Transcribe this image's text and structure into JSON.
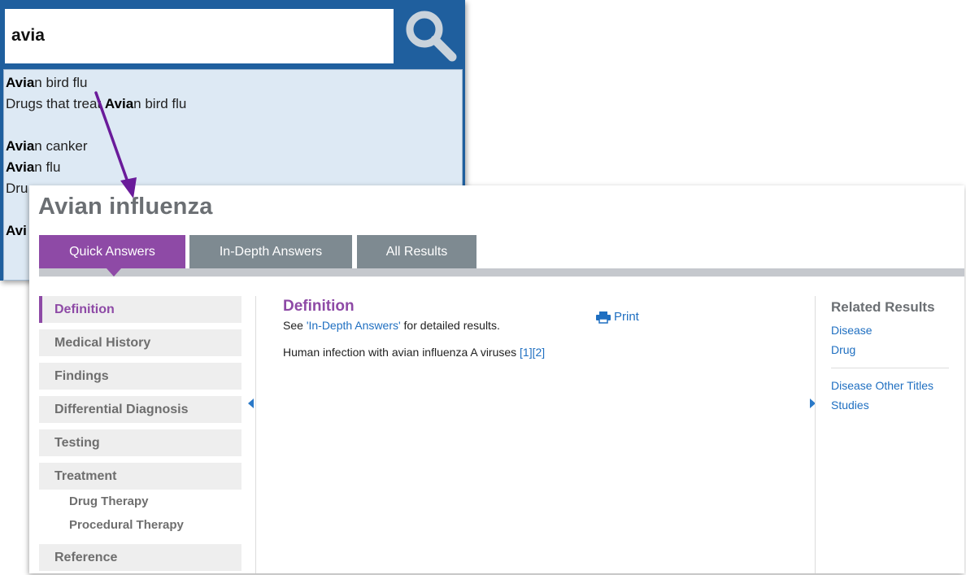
{
  "search": {
    "query": "avia",
    "suggestions": [
      {
        "match": "Avia",
        "rest": "n bird flu"
      },
      {
        "prefix": "Drugs that treat ",
        "match": "Avia",
        "rest": "n bird flu"
      },
      {
        "match": "Avia",
        "rest": "n canker"
      },
      {
        "match": "Avia",
        "rest": "n flu"
      },
      {
        "text": "Dru"
      },
      {
        "text": "Avi"
      }
    ]
  },
  "main": {
    "title": "Avian influenza",
    "tabs": [
      "Quick Answers",
      "In-Depth Answers",
      "All Results"
    ],
    "active_tab": "Quick Answers"
  },
  "nav": {
    "items": [
      "Definition",
      "Medical History",
      "Findings",
      "Differential Diagnosis",
      "Testing",
      "Treatment"
    ],
    "sub_items": [
      "Drug Therapy",
      "Procedural Therapy"
    ],
    "reference": "Reference",
    "active": "Definition"
  },
  "content": {
    "heading": "Definition",
    "see_prefix": "See ",
    "see_link": "'In-Depth Answers'",
    "see_suffix": " for detailed results.",
    "definition_text": "Human infection with avian influenza A viruses ",
    "ref1": "[1]",
    "ref2": "[2]",
    "print_label": "Print"
  },
  "related": {
    "heading": "Related Results",
    "group1": [
      "Disease",
      "Drug"
    ],
    "group2": [
      "Disease Other Titles",
      "Studies"
    ]
  },
  "colors": {
    "accent_purple": "#8e4aa6",
    "search_blue": "#1f5f9e",
    "link_blue": "#1f6fc1",
    "tab_gray": "#7e8a91",
    "annotation_arrow": "#6a1b9a"
  },
  "icons": {
    "search_button": "magnifier-icon",
    "print": "printer-icon",
    "left_collapse": "caret-left-icon",
    "right_expand": "caret-right-icon"
  }
}
